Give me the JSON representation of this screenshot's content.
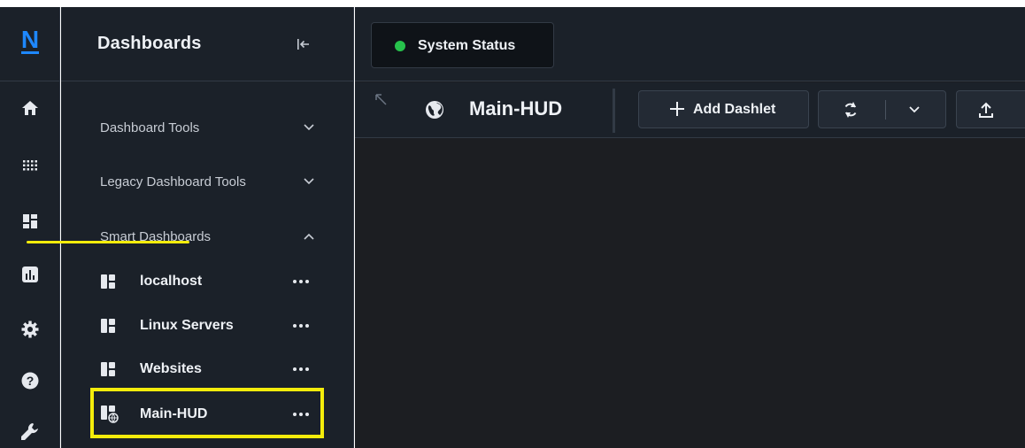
{
  "rail": {
    "logo_letter": "N",
    "items": [
      {
        "icon": "home-icon"
      },
      {
        "icon": "apps-grid-icon"
      },
      {
        "icon": "dashboard-icon"
      },
      {
        "icon": "bar-chart-icon"
      },
      {
        "icon": "gear-icon"
      },
      {
        "icon": "help-icon"
      },
      {
        "icon": "wrench-icon"
      }
    ]
  },
  "sidebar": {
    "title": "Dashboards",
    "sections": [
      {
        "label": "Dashboard Tools",
        "expanded": false
      },
      {
        "label": "Legacy Dashboard Tools",
        "expanded": false
      },
      {
        "label": "Smart Dashboards",
        "expanded": true
      }
    ],
    "dashboards": [
      {
        "label": "localhost",
        "more": "•••"
      },
      {
        "label": "Linux Servers",
        "more": "•••"
      },
      {
        "label": "Websites",
        "more": "•••"
      },
      {
        "label": "Main-HUD",
        "more": "•••"
      }
    ]
  },
  "header": {
    "status_tab": "System Status",
    "status_color": "#27c24c"
  },
  "toolbar": {
    "title": "Main-HUD",
    "add_label": "Add Dashlet"
  },
  "colors": {
    "accent_highlight": "#f4ec0b",
    "logo_blue": "#1e88ff",
    "background_dark": "#1b2129"
  }
}
